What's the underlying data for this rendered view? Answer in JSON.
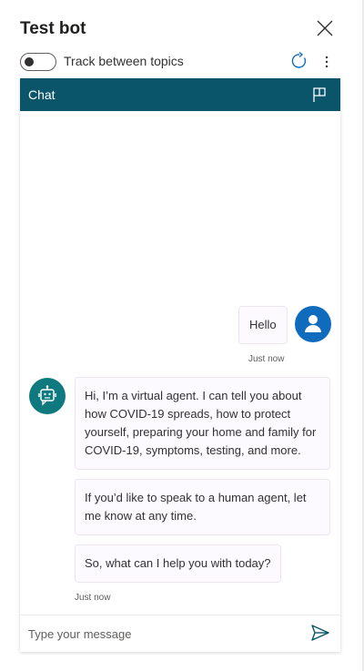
{
  "header": {
    "title": "Test bot",
    "close_icon": "close-icon"
  },
  "toolbar": {
    "toggle_label": "Track between topics",
    "toggle_on": false,
    "refresh_icon": "refresh-icon",
    "more_icon": "more-vertical-icon"
  },
  "chat": {
    "header_label": "Chat",
    "flag_icon": "flag-icon",
    "header_color": "#0b556a",
    "messages": [
      {
        "from": "user",
        "text": "Hello",
        "timestamp": "Just now"
      },
      {
        "from": "bot",
        "text": "Hi, I’m a virtual agent. I can tell you about how COVID-19 spreads, how to protect yourself, preparing your home and family for COVID-19, symptoms, testing, and more."
      },
      {
        "from": "bot",
        "text": "If you’d like to speak to a human agent, let me know at any time."
      },
      {
        "from": "bot",
        "text": "So, what can I help you with today?",
        "timestamp": "Just now"
      }
    ],
    "user_avatar_color": "#0f6cbd",
    "bot_avatar_color": "#0e7a80",
    "input": {
      "placeholder": "Type your message",
      "value": ""
    },
    "send_icon": "send-icon"
  }
}
